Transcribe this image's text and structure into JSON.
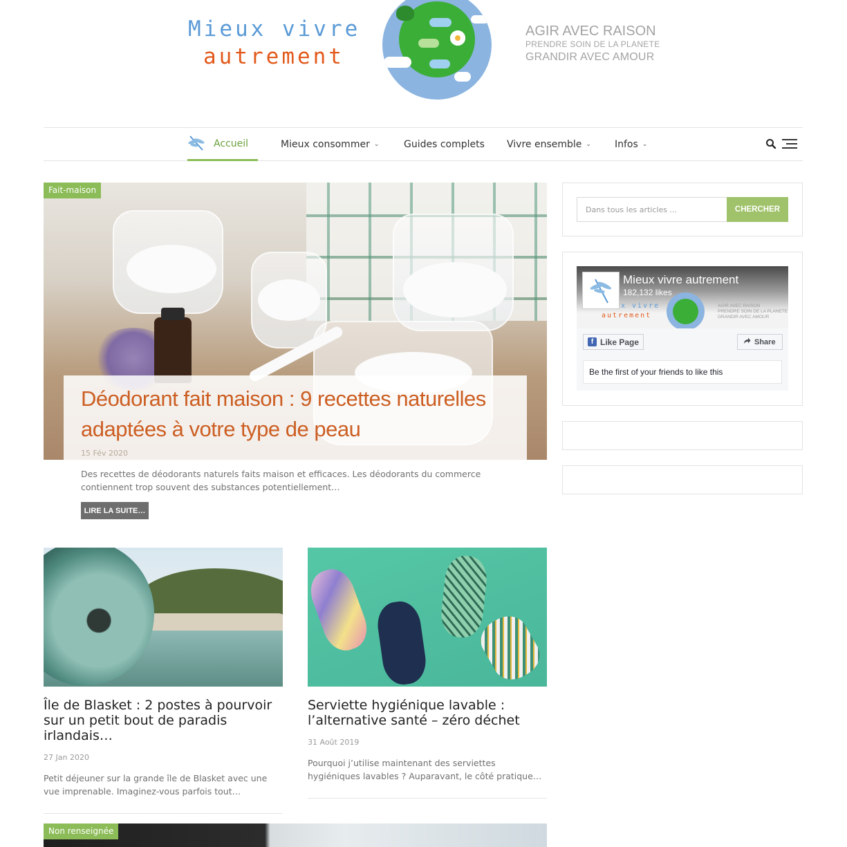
{
  "header": {
    "logo_line1": "Mieux vivre",
    "logo_line2": "autrement",
    "tagline1": "AGIR AVEC RAISON",
    "tagline2": "PRENDRE SOIN DE LA PLANETE",
    "tagline3": "GRANDIR AVEC AMOUR"
  },
  "nav": {
    "items": [
      {
        "label": "Accueil",
        "active": true
      },
      {
        "label": "Mieux consommer",
        "dropdown": true
      },
      {
        "label": "Guides complets"
      },
      {
        "label": "Vivre ensemble",
        "dropdown": true
      },
      {
        "label": "Infos",
        "dropdown": true
      }
    ],
    "dropdown_glyph": "⌄"
  },
  "featured": {
    "category": "Fait-maison",
    "title": "Déodorant fait maison : 9 recettes naturelles adaptées à votre type de peau",
    "date": "15 Fév 2020",
    "excerpt": "Des recettes de déodorants naturels faits maison et efficaces. Les déodorants du commerce contiennent trop souvent des substances potentiellement…",
    "read_more": "LIRE LA SUITE…"
  },
  "cards": [
    {
      "title": "Île de Blasket : 2 postes à pourvoir sur un petit bout de paradis irlandais…",
      "date": "27 Jan 2020",
      "excerpt": "Petit déjeuner sur la grande île de Blasket avec une vue imprenable. Imaginez-vous parfois tout…"
    },
    {
      "title": "Serviette hygiénique lavable : l’alternative santé – zéro déchet",
      "date": "31 Août 2019",
      "excerpt": "Pourquoi j’utilise maintenant des serviettes hygiéniques lavables ? Auparavant, le côté pratique…"
    }
  ],
  "next_post": {
    "category": "Non renseignée"
  },
  "sidebar": {
    "search": {
      "placeholder": "Dans tous les articles ...",
      "button": "CHERCHER"
    },
    "facebook": {
      "page_name": "Mieux vivre autrement",
      "likes": "182,132 likes",
      "cover_logo_line1": "x vivre",
      "cover_logo_line2": "autrement",
      "cover_tag1": "AGIR AVEC RAISON",
      "cover_tag2": "PRENDRE SOIN DE LA PLANETE",
      "cover_tag3": "GRANDIR AVEC AMOUR",
      "like_button": "Like Page",
      "share_button": "Share",
      "friends_text": "Be the first of your friends to like this"
    }
  },
  "colors": {
    "accent_green": "#8cbc58",
    "title_orange": "#cc5e22",
    "logo_blue": "#5a9ad6",
    "logo_orange": "#e25a1c",
    "facebook_blue": "#4267b2"
  }
}
